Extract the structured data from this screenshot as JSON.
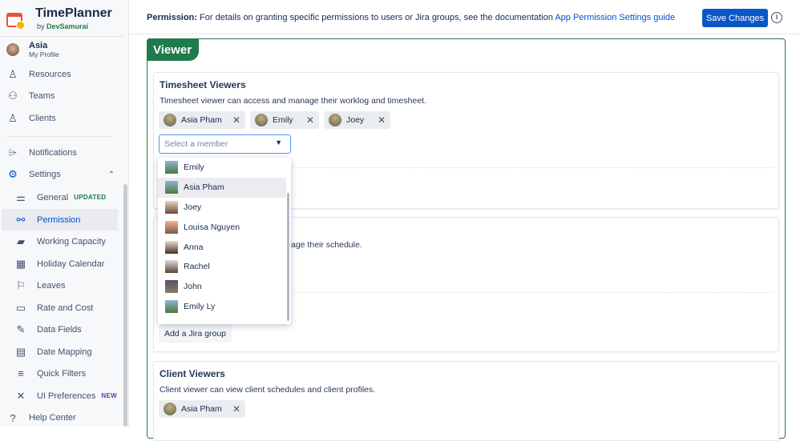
{
  "brand": {
    "title": "TimePlanner",
    "by": "by",
    "company": "DevSamurai"
  },
  "profile": {
    "name": "Asia",
    "sub": "My Profile"
  },
  "nav": [
    {
      "label": "Resources"
    },
    {
      "label": "Teams"
    },
    {
      "label": "Clients"
    },
    {
      "label": "Notifications"
    },
    {
      "label": "Settings"
    }
  ],
  "settings_items": [
    {
      "label": "General",
      "badge": "UPDATED"
    },
    {
      "label": "Permission"
    },
    {
      "label": "Working Capacity"
    },
    {
      "label": "Holiday Calendar"
    },
    {
      "label": "Leaves"
    },
    {
      "label": "Rate and Cost"
    },
    {
      "label": "Data Fields"
    },
    {
      "label": "Date Mapping"
    },
    {
      "label": "Quick Filters"
    },
    {
      "label": "UI Preferences",
      "badge": "NEW"
    }
  ],
  "help": "Help Center",
  "header": {
    "perm_label": "Permission:",
    "perm_text": "For details on granting specific permissions to users or Jira groups, see the documentation",
    "link": "App Permission Settings guide",
    "save": "Save Changes",
    "info": "i"
  },
  "viewer_tab": "Viewer",
  "timesheet": {
    "title": "Timesheet Viewers",
    "desc": "Timesheet viewer can access and manage their worklog and timesheet.",
    "members": [
      "Asia Pham",
      "Emily",
      "Joey"
    ],
    "placeholder": "Select a member"
  },
  "dropdown": [
    "Emily",
    "Asia Pham",
    "Joey",
    "Louisa Nguyen",
    "Anna",
    "Rachel",
    "John",
    "Emily Ly"
  ],
  "schedule_fragment": "age their schedule.",
  "add_group": "Add a Jira group",
  "client": {
    "title": "Client Viewers",
    "desc": "Client viewer can view client schedules and client profiles.",
    "members": [
      "Asia Pham"
    ]
  },
  "colors": {
    "accent": "#1f7a4d",
    "primary": "#0b57c8"
  }
}
